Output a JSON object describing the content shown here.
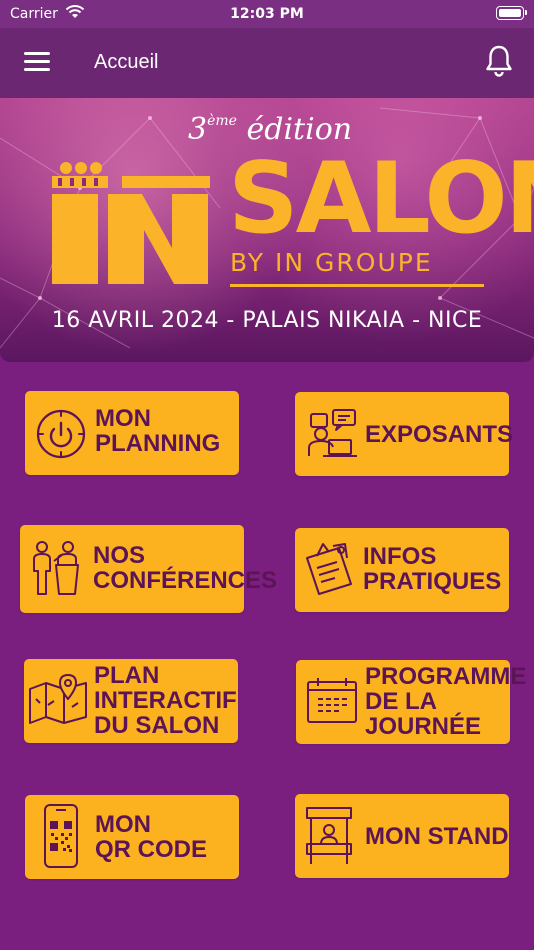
{
  "status_bar": {
    "carrier": "Carrier",
    "time": "12:03 PM"
  },
  "nav": {
    "title": "Accueil"
  },
  "banner": {
    "edition_number": "3",
    "edition_sup": "ème",
    "edition_word": "édition",
    "logo_word": "SALON",
    "byline": "BY IN GROUPE",
    "event_info": "16 AVRIL 2024 - PALAIS NIKAIA - NICE"
  },
  "tiles": {
    "planning": {
      "line1": "MON",
      "line2": "PLANNING"
    },
    "exposants": {
      "line1": "EXPOSANTS"
    },
    "conferences": {
      "line1": "NOS",
      "line2": "CONFÉRENCES"
    },
    "infos": {
      "line1": "INFOS",
      "line2": "PRATIQUES"
    },
    "plan": {
      "line1": "PLAN",
      "line2": "INTERACTIF",
      "line3": "DU SALON"
    },
    "programme": {
      "line1": "PROGRAMME",
      "line2": "DE LA",
      "line3": "JOURNÉE"
    },
    "qrcode": {
      "line1": "MON",
      "line2": "QR CODE"
    },
    "stand": {
      "line1": "MON STAND"
    }
  },
  "colors": {
    "background": "#7a1f80",
    "tile": "#fbb21e",
    "tile_text": "#5c1456",
    "brand_gold": "#fbb329"
  },
  "icons": {
    "planning": "power-clock-icon",
    "exposants": "exhibitors-icon",
    "conferences": "speaker-icon",
    "infos": "clipboard-icon",
    "plan": "map-pin-icon",
    "programme": "calendar-icon",
    "qrcode": "qr-phone-icon",
    "stand": "booth-icon",
    "menu": "hamburger-icon",
    "notifications": "bell-icon"
  }
}
